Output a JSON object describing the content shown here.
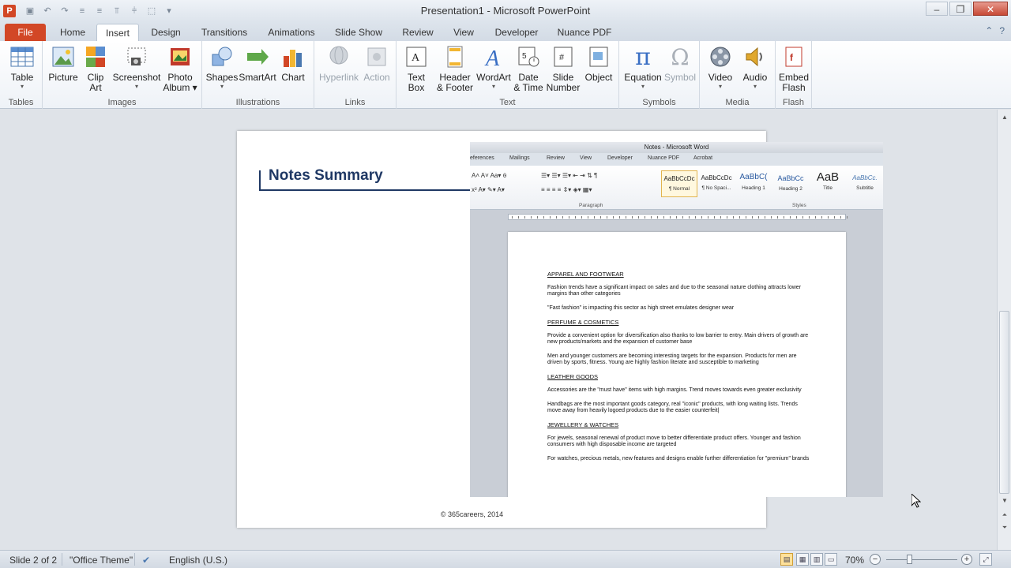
{
  "window": {
    "title": "Presentation1  -  Microsoft PowerPoint",
    "app_icon": "P",
    "controls": [
      "–",
      "❐",
      "✕"
    ]
  },
  "qat": [
    "save-icon",
    "undo-icon",
    "redo-icon",
    "align-icon",
    "align-icon",
    "align-icon",
    "align-icon",
    "align-icon",
    "dropdown-icon"
  ],
  "tabs": [
    {
      "label": "File"
    },
    {
      "label": "Home"
    },
    {
      "label": "Insert"
    },
    {
      "label": "Design"
    },
    {
      "label": "Transitions"
    },
    {
      "label": "Animations"
    },
    {
      "label": "Slide Show"
    },
    {
      "label": "Review"
    },
    {
      "label": "View"
    },
    {
      "label": "Developer"
    },
    {
      "label": "Nuance PDF"
    }
  ],
  "ribbon": {
    "groups": {
      "tables": "Tables",
      "images": "Images",
      "illustrations": "Illustrations",
      "links": "Links",
      "text": "Text",
      "symbols": "Symbols",
      "media": "Media",
      "flash": "Flash"
    },
    "buttons": {
      "table": {
        "line1": "Table",
        "line2": ""
      },
      "picture": {
        "line1": "Picture",
        "line2": ""
      },
      "clip_art": {
        "line1": "Clip",
        "line2": "Art"
      },
      "screenshot": {
        "line1": "Screenshot",
        "line2": ""
      },
      "photo_album": {
        "line1": "Photo",
        "line2": "Album ▾"
      },
      "shapes": {
        "line1": "Shapes",
        "line2": ""
      },
      "smartart": {
        "line1": "SmartArt",
        "line2": ""
      },
      "chart": {
        "line1": "Chart",
        "line2": ""
      },
      "hyperlink": {
        "line1": "Hyperlink",
        "line2": ""
      },
      "action": {
        "line1": "Action",
        "line2": ""
      },
      "text_box": {
        "line1": "Text",
        "line2": "Box"
      },
      "header_footer": {
        "line1": "Header",
        "line2": "& Footer"
      },
      "wordart": {
        "line1": "WordArt",
        "line2": ""
      },
      "date_time": {
        "line1": "Date",
        "line2": "& Time"
      },
      "slide_number": {
        "line1": "Slide",
        "line2": "Number"
      },
      "object": {
        "line1": "Object",
        "line2": ""
      },
      "equation": {
        "line1": "Equation",
        "line2": ""
      },
      "symbol": {
        "line1": "Symbol",
        "line2": ""
      },
      "video": {
        "line1": "Video",
        "line2": ""
      },
      "audio": {
        "line1": "Audio",
        "line2": ""
      },
      "embed_flash": {
        "line1": "Embed",
        "line2": "Flash"
      }
    }
  },
  "slide": {
    "title": "Notes Summary",
    "footer": "© 365careers, 2014"
  },
  "word": {
    "title": "Notes - Microsoft Word",
    "tabs": [
      "eferences",
      "Mailings",
      "Review",
      "View",
      "Developer",
      "Nuance PDF",
      "Acrobat"
    ],
    "group_paragraph": "Paragraph",
    "group_styles": "Styles",
    "styles": [
      {
        "preview": "AaBbCcDc",
        "name": "¶ Normal"
      },
      {
        "preview": "AaBbCcDc",
        "name": "¶ No Spaci..."
      },
      {
        "preview": "AaBbC(",
        "name": "Heading 1"
      },
      {
        "preview": "AaBbCc",
        "name": "Heading 2"
      },
      {
        "preview": "AaB",
        "name": "Title"
      },
      {
        "preview": "AaBbCc.",
        "name": "Subtitle"
      }
    ],
    "doc": [
      {
        "type": "h",
        "text": "APPAREL AND FOOTWEAR"
      },
      {
        "type": "p",
        "text": "Fashion trends have a significant impact on sales and due to the seasonal nature clothing attracts lower margins than other categories"
      },
      {
        "type": "p",
        "text": "\"Fast fashion\" is impacting this sector as high street emulates designer wear"
      },
      {
        "type": "h",
        "text": "PERFUME & COSMETICS"
      },
      {
        "type": "p",
        "text": "Provide a convenient option for diversification also thanks to low barrier to entry. Main drivers of growth are new products/markets and the expansion of customer base"
      },
      {
        "type": "p",
        "text": "Men and younger customers are becoming interesting targets for the expansion. Products for men are driven by sports, fitness. Young are highly fashion literate and susceptible to marketing"
      },
      {
        "type": "h",
        "text": "LEATHER GOODS"
      },
      {
        "type": "p",
        "text": "Accessories are the \"must have\" items with high margins. Trend moves towards even greater exclusivity"
      },
      {
        "type": "p",
        "text": "Handbags are the most important goods category, real \"iconic\" products, with long waiting lists. Trends move away from heavily logoed products due to the easier counterfeit|"
      },
      {
        "type": "h",
        "text": "JEWELLERY & WATCHES"
      },
      {
        "type": "p",
        "text": "For jewels, seasonal renewal of product move to better differentiate product offers. Younger and fashion consumers with high disposable income are targeted"
      },
      {
        "type": "p",
        "text": "For watches, precious metals, new features and designs enable further differentiation for \"premium\" brands"
      }
    ]
  },
  "status": {
    "slide": "Slide 2 of 2",
    "theme": "\"Office Theme\"",
    "language": "English (U.S.)",
    "zoom": "70%"
  },
  "colors": {
    "accent": "#d24726",
    "title_blue": "#1f3864"
  }
}
